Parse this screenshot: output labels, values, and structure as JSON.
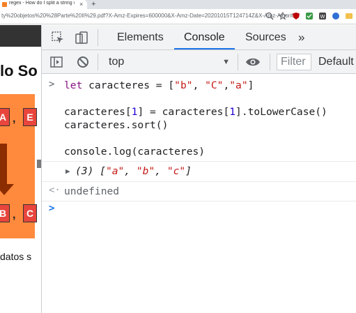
{
  "browser": {
    "tab_title": "regex - How do I split a string wi",
    "tab_close": "×",
    "new_tab": "+",
    "url": "ty%20objetos%20%28Parte%20II%29.pdf?X-Amz-Expires=600000&X-Amz-Date=20201015T124714Z&X-Amz-Algorithm=AWS..."
  },
  "page": {
    "heading": "lo So",
    "letters": [
      "A",
      "E",
      "B",
      "C"
    ],
    "commas": [
      ",",
      ","
    ],
    "body_text": "datos s"
  },
  "devtools": {
    "tabs": [
      "Elements",
      "Console",
      "Sources"
    ],
    "active_tab": "Console",
    "more": "»",
    "context": "top",
    "filter_placeholder": "Filter",
    "levels": "Default"
  },
  "console": {
    "input1_kw": "let",
    "input1_a": " caracteres = [",
    "input1_b": "\"b\"",
    "input1_c": ", ",
    "input1_d": "\"C\"",
    "input1_e": ",",
    "input1_f": "\"a\"",
    "input1_g": "]",
    "input2_a": "caracteres[",
    "input2_b": "1",
    "input2_c": "] = caracteres[",
    "input2_d": "1",
    "input2_e": "].toLowerCase()",
    "input3": "caracteres.sort()",
    "input4": "console.log(caracteres)",
    "log_count": "(3) [",
    "log_a": "\"a\"",
    "log_sep1": ", ",
    "log_b": "\"b\"",
    "log_sep2": ", ",
    "log_c": "\"c\"",
    "log_end": "]",
    "result": "undefined"
  }
}
